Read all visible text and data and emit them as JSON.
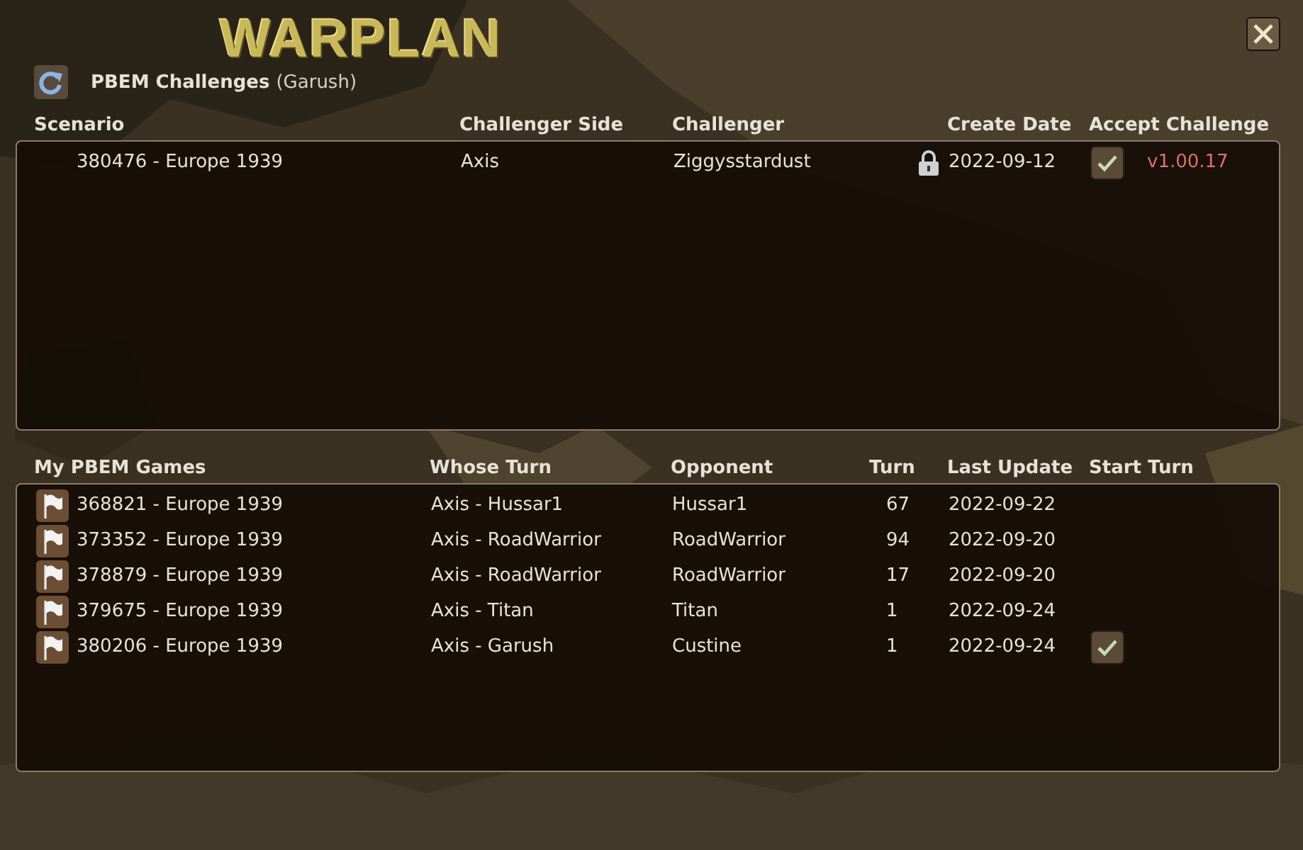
{
  "logo": "WARPLAN",
  "header": {
    "title": "PBEM Challenges",
    "user": "(Garush)"
  },
  "challenges": {
    "columns": [
      "Scenario",
      "Challenger Side",
      "Challenger",
      "Create Date",
      "Accept Challenge"
    ],
    "rows": [
      {
        "scenario": "380476 - Europe 1939",
        "side": "Axis",
        "challenger": "Ziggysstardust",
        "locked": true,
        "date": "2022-09-12",
        "accept": true,
        "version": "v1.00.17"
      }
    ]
  },
  "games": {
    "columns": [
      "My PBEM Games",
      "Whose Turn",
      "Opponent",
      "Turn",
      "Last Update",
      "Start Turn"
    ],
    "rows": [
      {
        "game": "368821 - Europe 1939",
        "whose_turn": "Axis - Hussar1",
        "opponent": "Hussar1",
        "turn": "67",
        "updated": "2022-09-22",
        "start_turn": false
      },
      {
        "game": "373352 - Europe 1939",
        "whose_turn": "Axis - RoadWarrior",
        "opponent": "RoadWarrior",
        "turn": "94",
        "updated": "2022-09-20",
        "start_turn": false
      },
      {
        "game": "378879 - Europe 1939",
        "whose_turn": "Axis - RoadWarrior",
        "opponent": "RoadWarrior",
        "turn": "17",
        "updated": "2022-09-20",
        "start_turn": false
      },
      {
        "game": "379675 - Europe 1939",
        "whose_turn": "Axis - Titan",
        "opponent": "Titan",
        "turn": "1",
        "updated": "2022-09-24",
        "start_turn": false
      },
      {
        "game": "380206 - Europe 1939",
        "whose_turn": "Axis - Garush",
        "opponent": "Custine",
        "turn": "1",
        "updated": "2022-09-24",
        "start_turn": true
      }
    ]
  }
}
